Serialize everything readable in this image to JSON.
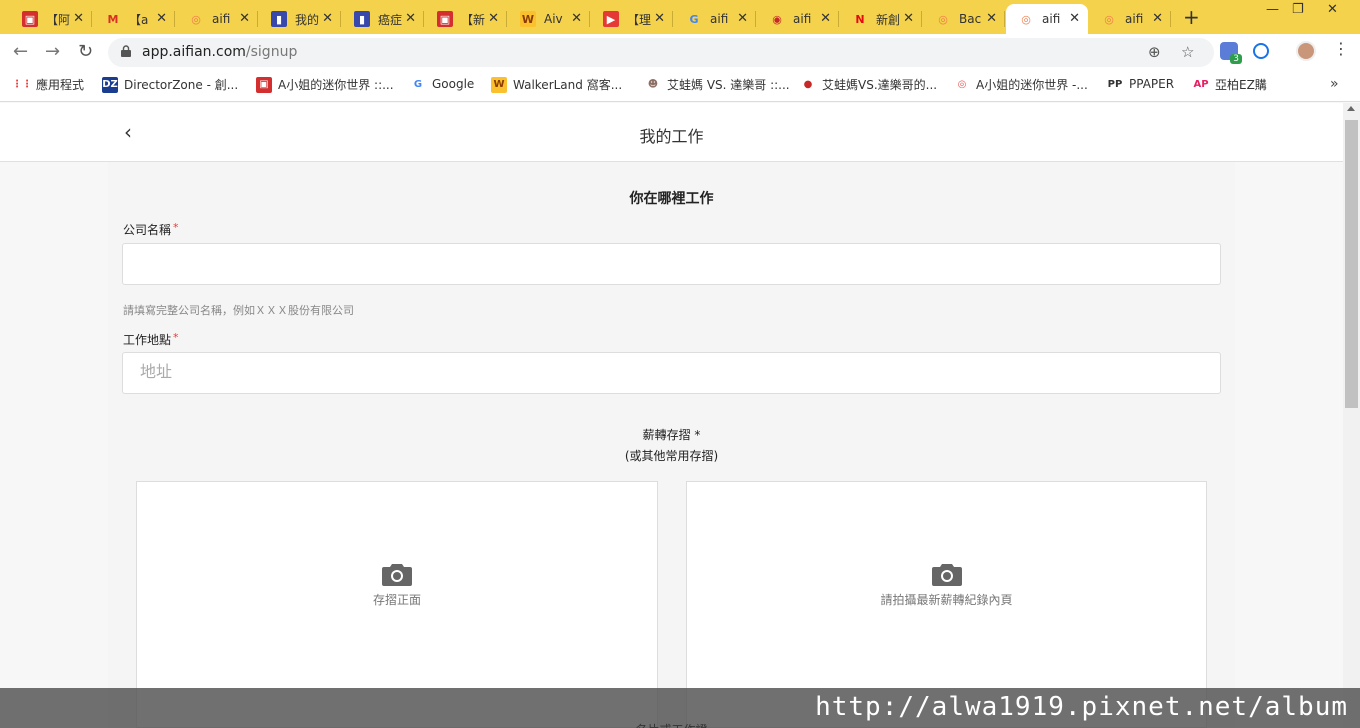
{
  "browser": {
    "tabs": [
      {
        "title": "【阿",
        "fav": "▣",
        "fav_bg": "#d32f2f",
        "fav_color": "#fff"
      },
      {
        "title": "【a",
        "fav": "M",
        "fav_bg": "transparent",
        "fav_color": "#d93025"
      },
      {
        "title": "aifi",
        "fav": "◎",
        "fav_bg": "transparent",
        "fav_color": "#f07a4a"
      },
      {
        "title": "我的",
        "fav": "▮",
        "fav_bg": "#3949ab",
        "fav_color": "#fff"
      },
      {
        "title": "癌症",
        "fav": "▮",
        "fav_bg": "#3949ab",
        "fav_color": "#fff"
      },
      {
        "title": "【新",
        "fav": "▣",
        "fav_bg": "#d32f2f",
        "fav_color": "#fff"
      },
      {
        "title": "Aiv",
        "fav": "W",
        "fav_bg": "#fbc02d",
        "fav_color": "#8a3b00"
      },
      {
        "title": "【理",
        "fav": "▶",
        "fav_bg": "#e53935",
        "fav_color": "#fff"
      },
      {
        "title": "aifi",
        "fav": "G",
        "fav_bg": "transparent",
        "fav_color": "#4285f4"
      },
      {
        "title": "aifi",
        "fav": "◉",
        "fav_bg": "transparent",
        "fav_color": "#c62828"
      },
      {
        "title": "新創",
        "fav": "N",
        "fav_bg": "transparent",
        "fav_color": "#e50914"
      },
      {
        "title": "Bac",
        "fav": "◎",
        "fav_bg": "transparent",
        "fav_color": "#f07a4a"
      },
      {
        "title": "aifi",
        "fav": "◎",
        "fav_bg": "transparent",
        "fav_color": "#f07a4a",
        "active": true
      },
      {
        "title": "aifi",
        "fav": "◎",
        "fav_bg": "transparent",
        "fav_color": "#f07a4a"
      }
    ],
    "url_host": "app.aifian.com",
    "url_path": "/signup",
    "extension_badge": "3",
    "bookmarks": [
      {
        "label": "應用程式",
        "fav": "⋮⋮",
        "fav_bg": "transparent",
        "fav_color": "#e53935"
      },
      {
        "label": "DirectorZone - 創...",
        "fav": "DZ",
        "fav_bg": "#1a3d8f",
        "fav_color": "#fff"
      },
      {
        "label": "A小姐的迷你世界 ::...",
        "fav": "▣",
        "fav_bg": "#d32f2f",
        "fav_color": "#fff"
      },
      {
        "label": "Google",
        "fav": "G",
        "fav_bg": "transparent",
        "fav_color": "#4285f4"
      },
      {
        "label": "WalkerLand 窩客...",
        "fav": "W",
        "fav_bg": "#fbc02d",
        "fav_color": "#8a3b00"
      },
      {
        "label": "艾蛙媽 VS. 達樂哥 ::...",
        "fav": "☻",
        "fav_bg": "transparent",
        "fav_color": "#8d6e63"
      },
      {
        "label": "艾蛙媽VS.達樂哥的...",
        "fav": "●",
        "fav_bg": "transparent",
        "fav_color": "#c62828"
      },
      {
        "label": "A小姐的迷你世界 -...",
        "fav": "◎",
        "fav_bg": "transparent",
        "fav_color": "#ef5350"
      },
      {
        "label": "PPAPER",
        "fav": "PP",
        "fav_bg": "transparent",
        "fav_color": "#333"
      },
      {
        "label": "亞柏EZ購",
        "fav": "AP",
        "fav_bg": "transparent",
        "fav_color": "#e91e63"
      }
    ]
  },
  "app": {
    "title": "我的工作",
    "section_title": "你在哪裡工作",
    "company_label": "公司名稱",
    "company_value": "",
    "company_hint": "請填寫完整公司名稱，例如ＸＸＸ股份有限公司",
    "location_label": "工作地點",
    "location_placeholder": "地址",
    "required_mark": "*",
    "salary_label": "薪轉存摺 *",
    "salary_sub": "(或其他常用存摺)",
    "upload_left": "存摺正面",
    "upload_right": "請拍攝最新薪轉紀錄內頁",
    "next_label": "名片或工作證"
  },
  "watermark": "http://alwa1919.pixnet.net/album"
}
